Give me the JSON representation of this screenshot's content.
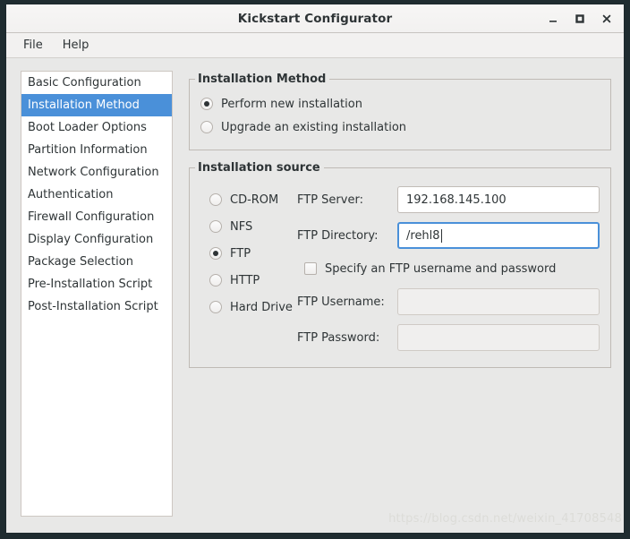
{
  "window": {
    "title": "Kickstart Configurator",
    "buttons": {
      "minimize": "minimize",
      "maximize": "maximize",
      "close": "close"
    }
  },
  "menubar": {
    "items": [
      {
        "label": "File"
      },
      {
        "label": "Help"
      }
    ]
  },
  "sidebar": {
    "items": [
      {
        "label": "Basic Configuration",
        "selected": false
      },
      {
        "label": "Installation Method",
        "selected": true
      },
      {
        "label": "Boot Loader Options",
        "selected": false
      },
      {
        "label": "Partition Information",
        "selected": false
      },
      {
        "label": "Network Configuration",
        "selected": false
      },
      {
        "label": "Authentication",
        "selected": false
      },
      {
        "label": "Firewall Configuration",
        "selected": false
      },
      {
        "label": "Display Configuration",
        "selected": false
      },
      {
        "label": "Package Selection",
        "selected": false
      },
      {
        "label": "Pre-Installation Script",
        "selected": false
      },
      {
        "label": "Post-Installation Script",
        "selected": false
      }
    ]
  },
  "install_method": {
    "title": "Installation Method",
    "options": [
      {
        "label": "Perform new installation",
        "checked": true
      },
      {
        "label": "Upgrade an existing installation",
        "checked": false
      }
    ]
  },
  "install_source": {
    "title": "Installation source",
    "options": [
      {
        "label": "CD-ROM",
        "checked": false
      },
      {
        "label": "NFS",
        "checked": false
      },
      {
        "label": "FTP",
        "checked": true
      },
      {
        "label": "HTTP",
        "checked": false
      },
      {
        "label": "Hard Drive",
        "checked": false
      }
    ],
    "ftp_server": {
      "label": "FTP Server:",
      "value": "192.168.145.100",
      "placeholder": ""
    },
    "ftp_directory": {
      "label": "FTP Directory:",
      "value": "/rehl8",
      "placeholder": "",
      "focused": true
    },
    "specify_credentials": {
      "label": "Specify an FTP username and password",
      "checked": false
    },
    "ftp_username": {
      "label": "FTP Username:",
      "value": "",
      "placeholder": "",
      "disabled": true
    },
    "ftp_password": {
      "label": "FTP Password:",
      "value": "",
      "placeholder": "",
      "disabled": true
    }
  },
  "watermark": {
    "text": "https://blog.csdn.net/weixin_41708548"
  },
  "colors": {
    "selection": "#4a90d9",
    "focus_border": "#4a90d9",
    "window_bg": "#e8e8e7",
    "titlebar_bg": "#f5f4f2",
    "frame_border": "#1d292d"
  }
}
